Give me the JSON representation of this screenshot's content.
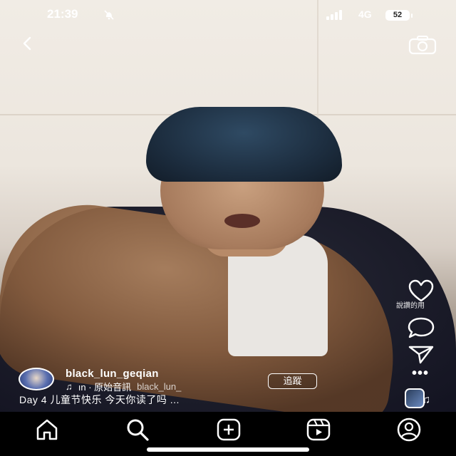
{
  "status_bar": {
    "time": "21:39",
    "network": "4G",
    "battery": "52",
    "icons": [
      "bell-off-icon",
      "signal-icon",
      "battery-icon"
    ]
  },
  "header": {
    "back_icon": "chevron-left-icon",
    "camera_icon": "camera-icon"
  },
  "right_rail": {
    "like_icon": "heart-icon",
    "like_caption": "說讚的用",
    "comment_icon": "comment-icon",
    "share_icon": "send-icon",
    "more_label": "•••",
    "audio_icon": "music-note-icon"
  },
  "post": {
    "username": "black_lun_geqian",
    "music_prefix": "♫",
    "music_text": "ın · 原始音訊",
    "music_text_2": "black_lun_",
    "follow_label": "追蹤",
    "caption": "Day 4 儿童节快乐 今天你读了吗 ..."
  },
  "nav": {
    "items": [
      {
        "name": "home",
        "icon": "home-icon"
      },
      {
        "name": "search",
        "icon": "search-icon"
      },
      {
        "name": "create",
        "icon": "plus-square-icon"
      },
      {
        "name": "reels",
        "icon": "reels-icon"
      },
      {
        "name": "profile",
        "icon": "profile-icon"
      }
    ]
  },
  "colors": {
    "text": "#ffffff",
    "nav_bg": "#000000"
  }
}
